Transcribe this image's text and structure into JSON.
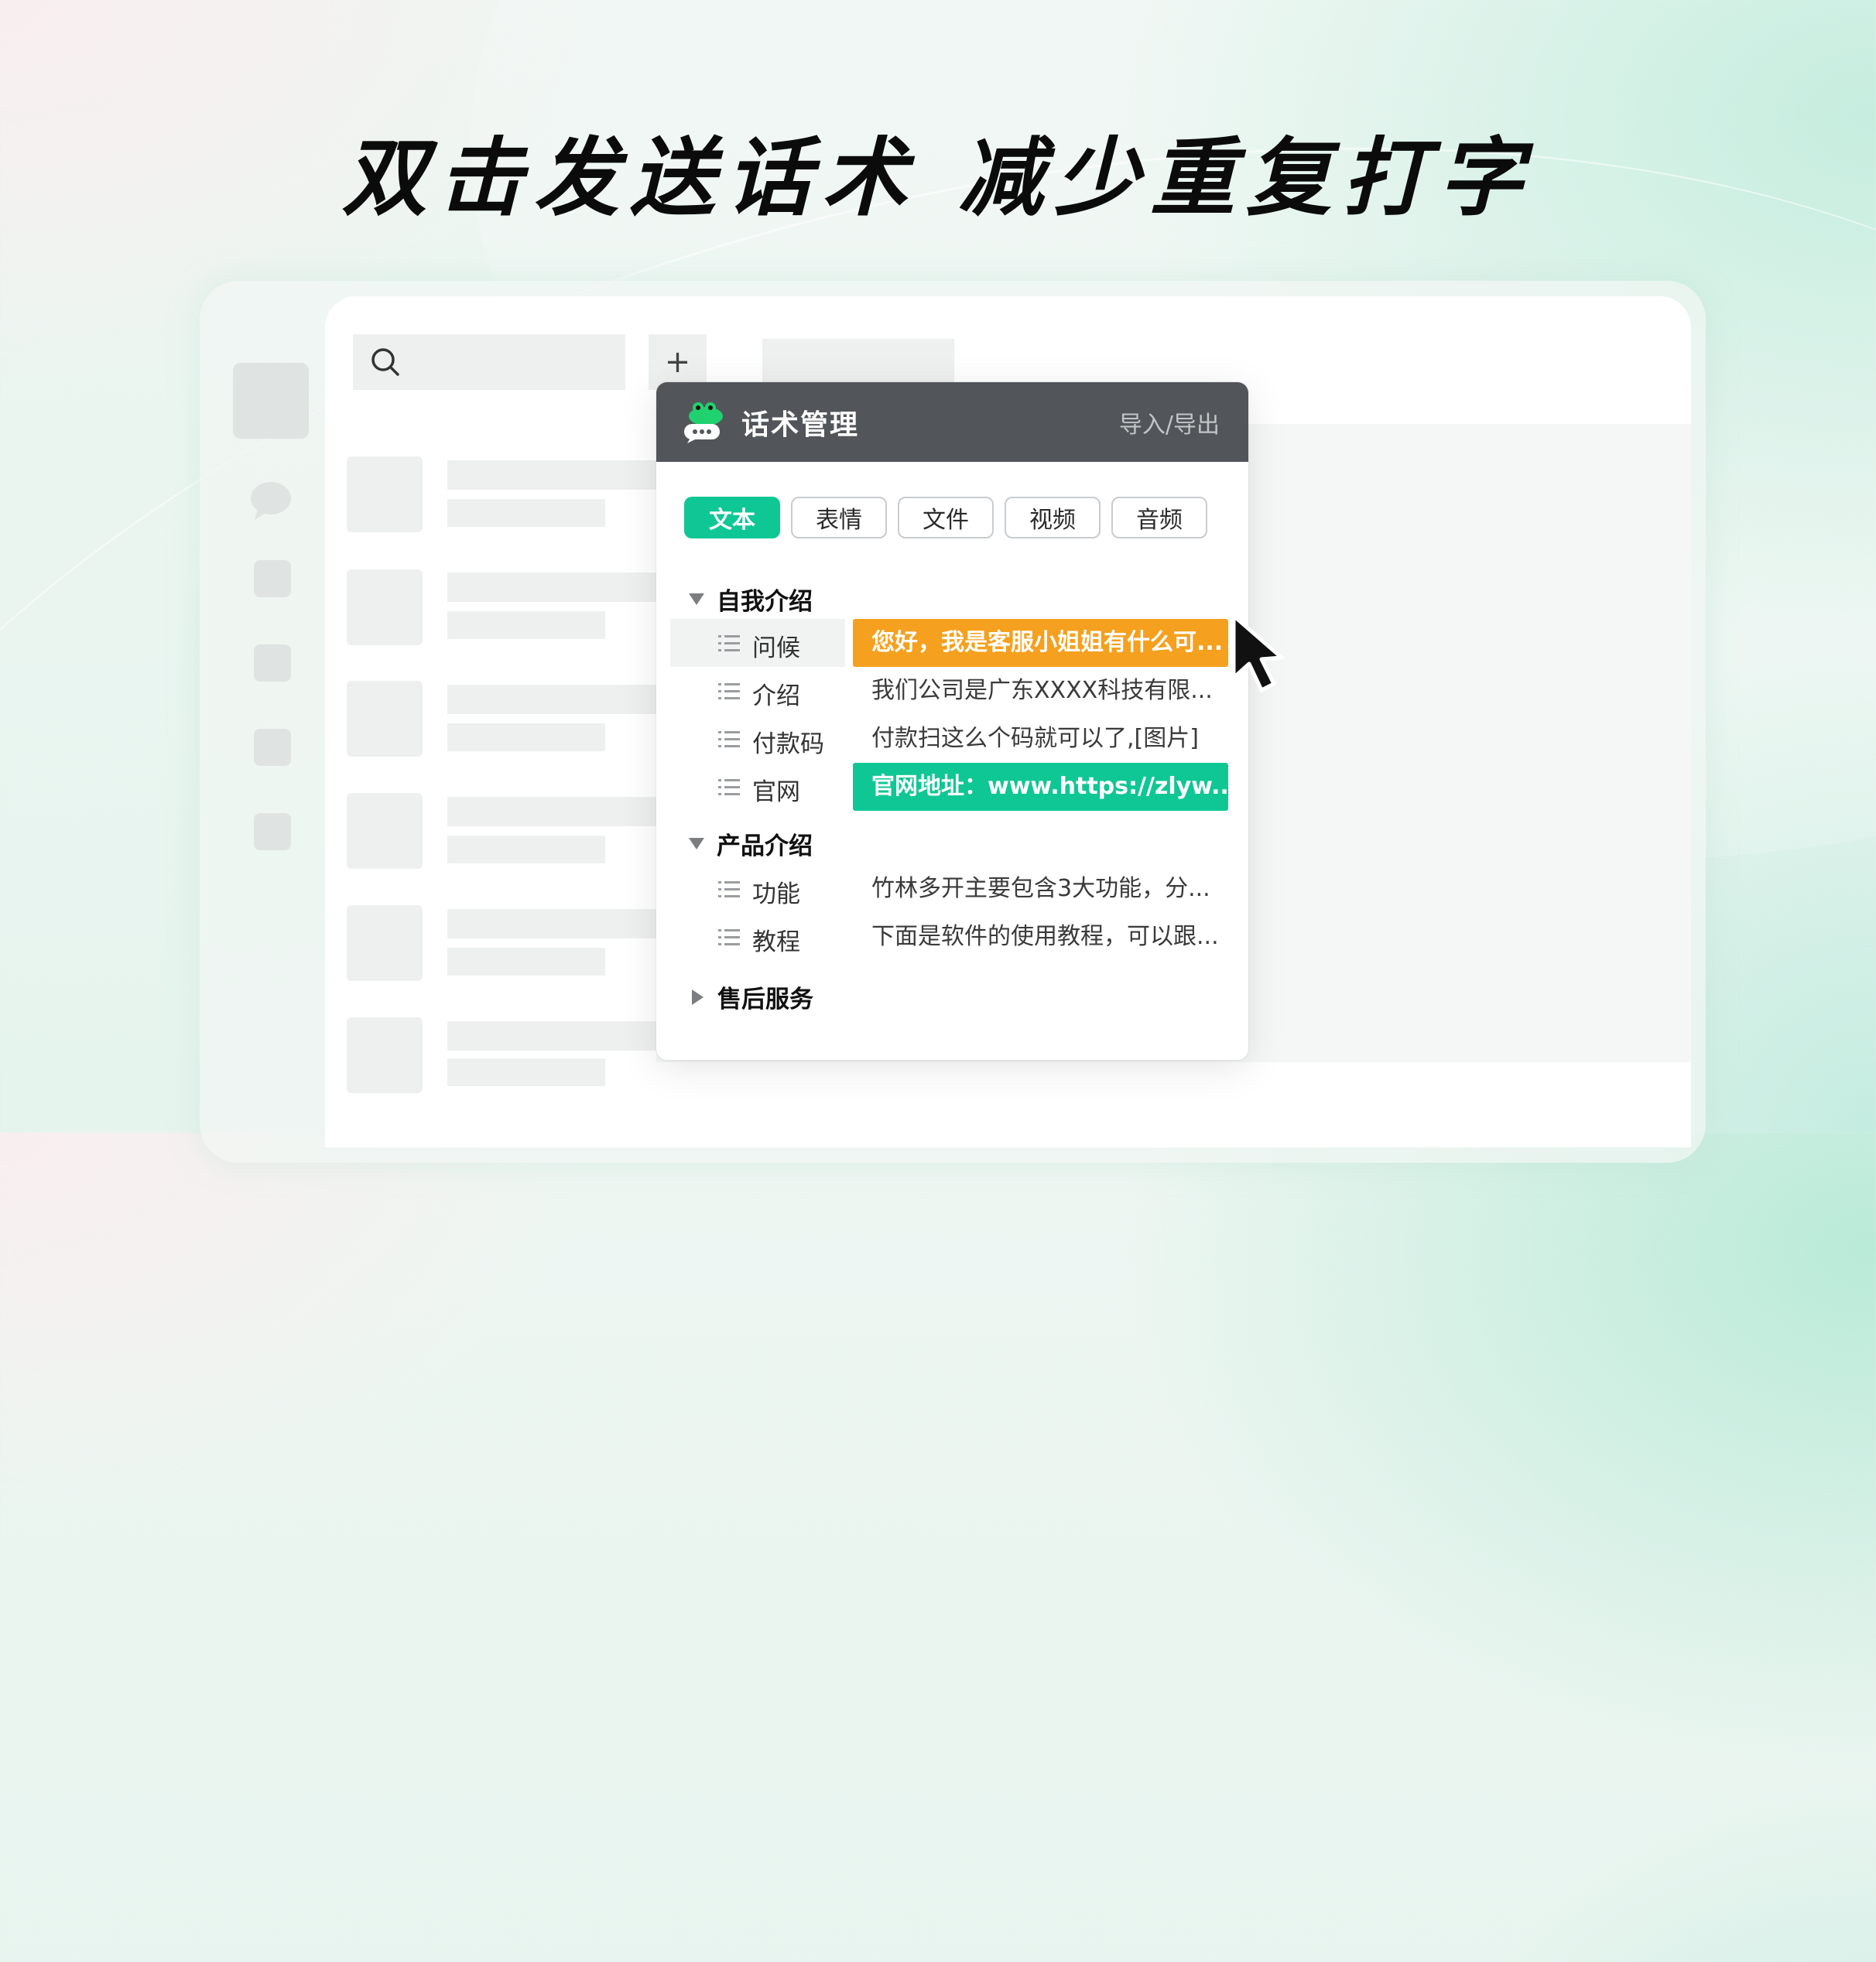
{
  "headline": "双击发送话术 减少重复打字",
  "app": {
    "toolbar": {
      "plus": "+"
    }
  },
  "panel": {
    "title": "话术管理",
    "import_export": "导入/导出",
    "tabs": [
      {
        "label": "文本",
        "active": true
      },
      {
        "label": "表情",
        "active": false
      },
      {
        "label": "文件",
        "active": false
      },
      {
        "label": "视频",
        "active": false
      },
      {
        "label": "音频",
        "active": false
      }
    ],
    "groups": [
      {
        "name": "自我介绍",
        "expanded": true,
        "items": [
          {
            "name": "问候",
            "content": "您好，我是客服小姐姐有什么可...",
            "highlight": "orange"
          },
          {
            "name": "介绍",
            "content": "我们公司是广东XXXX科技有限...",
            "highlight": "none"
          },
          {
            "name": "付款码",
            "content": "付款扫这么个码就可以了,[图片]",
            "highlight": "none"
          },
          {
            "name": "官网",
            "content": "官网地址：www.https://zlyw...",
            "highlight": "green"
          }
        ]
      },
      {
        "name": "产品介绍",
        "expanded": true,
        "items": [
          {
            "name": "功能",
            "content": "竹林多开主要包含3大功能，分...",
            "highlight": "none"
          },
          {
            "name": "教程",
            "content": "下面是软件的使用教程，可以跟...",
            "highlight": "none"
          }
        ]
      },
      {
        "name": "售后服务",
        "expanded": false,
        "items": []
      }
    ]
  },
  "colors": {
    "accent_green": "#0fc795",
    "highlight_orange": "#f5a01e",
    "header_gray": "#52565a"
  },
  "icons": {
    "search": "search-icon",
    "plus": "plus-icon",
    "logo": "bamboo-frog-logo-icon",
    "list": "list-icon",
    "cursor": "mouse-pointer-icon"
  }
}
